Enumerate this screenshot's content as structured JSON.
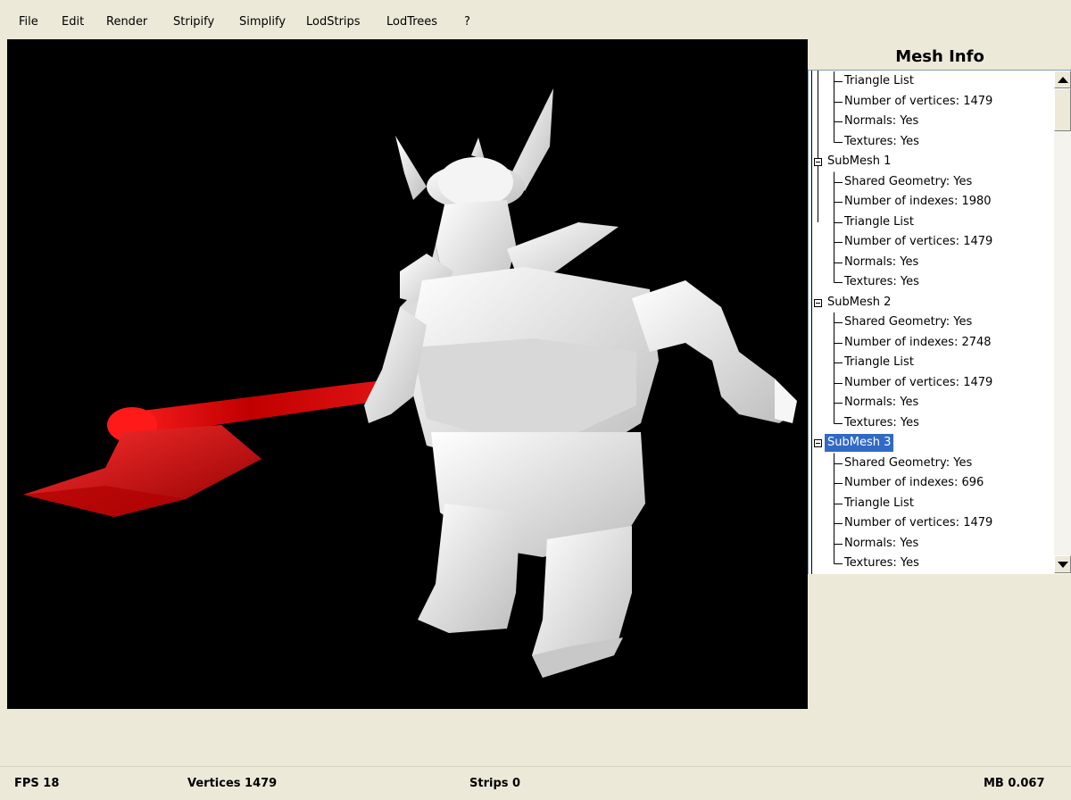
{
  "menu": [
    "File",
    "Edit",
    "Render",
    "Stripify",
    "Simplify",
    "LodStrips",
    "LodTrees",
    "?"
  ],
  "panel": {
    "title": "Mesh Info",
    "partial_items": [
      "Triangle List",
      "Number of vertices: 1479",
      "Normals: Yes",
      "Textures: Yes"
    ],
    "submeshes": [
      {
        "label": "SubMesh 1",
        "items": [
          "Shared Geometry: Yes",
          "Number of indexes: 1980",
          "Triangle List",
          "Number of vertices: 1479",
          "Normals: Yes",
          "Textures: Yes"
        ]
      },
      {
        "label": "SubMesh 2",
        "items": [
          "Shared Geometry: Yes",
          "Number of indexes: 2748",
          "Triangle List",
          "Number of vertices: 1479",
          "Normals: Yes",
          "Textures: Yes"
        ]
      },
      {
        "label": "SubMesh 3",
        "selected": true,
        "items": [
          "Shared Geometry: Yes",
          "Number of indexes: 696",
          "Triangle List",
          "Number of vertices: 1479",
          "Normals: Yes",
          "Textures: Yes"
        ]
      }
    ]
  },
  "status": {
    "fps": "FPS 18",
    "vertices": "Vertices 1479",
    "strips": "Strips 0",
    "mb": "MB 0.067"
  },
  "colors": {
    "selection": "#316ac5",
    "axe": "#e01010",
    "model": "#e6e6e6",
    "viewport_bg": "#000000"
  }
}
